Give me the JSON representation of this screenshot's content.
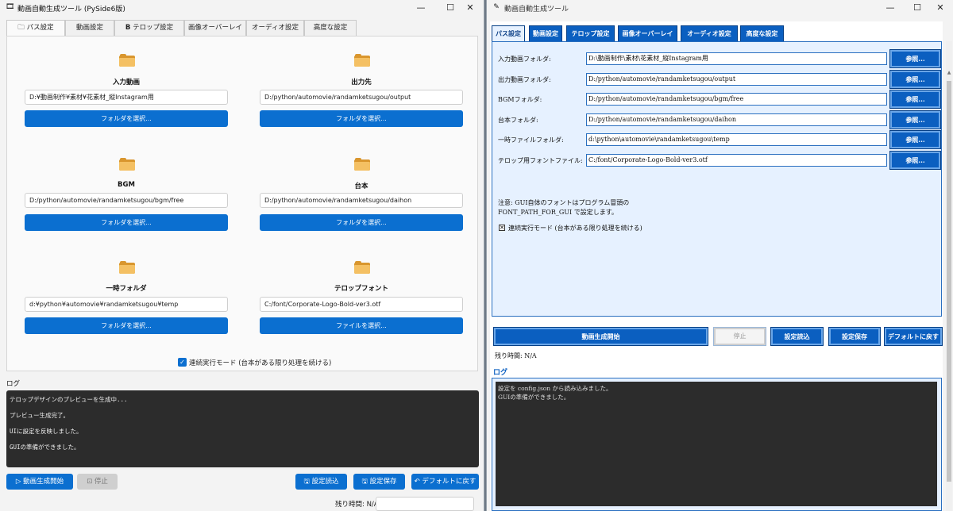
{
  "w1": {
    "title": "動画自動生成ツール (PySide6版)",
    "window_controls": {
      "minimize": "—",
      "maximize": "☐",
      "close": "✕"
    },
    "tabs": [
      {
        "icon": "🗀",
        "label": "パス設定"
      },
      {
        "icon": "",
        "label": "動画設定"
      },
      {
        "icon": "B",
        "label": "テロップ設定"
      },
      {
        "icon": "",
        "label": "画像オーバーレイ"
      },
      {
        "icon": "",
        "label": "オーディオ設定"
      },
      {
        "icon": "",
        "label": "高度な設定"
      }
    ],
    "paths": [
      {
        "label": "入力動画",
        "value": "D:¥動画制作¥素材¥花素材_縦Instagram用",
        "button": "フォルダを選択..."
      },
      {
        "label": "出力先",
        "value": "D:/python/automovie/randamketsugou/output",
        "button": "フォルダを選択..."
      },
      {
        "label": "BGM",
        "value": "D:/python/automovie/randamketsugou/bgm/free",
        "button": "フォルダを選択..."
      },
      {
        "label": "台本",
        "value": "D:/python/automovie/randamketsugou/daihon",
        "button": "フォルダを選択..."
      },
      {
        "label": "一時フォルダ",
        "value": "d:¥python¥automovie¥randamketsugou¥temp",
        "button": "フォルダを選択..."
      },
      {
        "label": "テロップフォント",
        "value": "C:/font/Corporate-Logo-Bold-ver3.otf",
        "button": "ファイルを選択..."
      }
    ],
    "continuous": {
      "checked": "✓",
      "label": "連続実行モード (台本がある限り処理を続ける)"
    },
    "log_label": "ログ",
    "log_lines": [
      "テロップデザインのプレビューを生成中...",
      "プレビュー生成完了。",
      "UIに設定を反映しました。",
      "GUIの準備ができました。"
    ],
    "buttons": {
      "start": "▷ 動画生成開始",
      "stop": "⊡ 停止",
      "load": "🖫 設定読込",
      "save": "🖫 設定保存",
      "reset": "↶ デフォルトに戻す"
    },
    "remaining": "残り時間: N/A"
  },
  "w2": {
    "title": "動画自動生成ツール",
    "window_controls": {
      "minimize": "—",
      "maximize": "☐",
      "close": "✕"
    },
    "tabs": [
      "パス設定",
      "動画設定",
      "テロップ設定",
      "画像オーバーレイ",
      "オーディオ設定",
      "高度な設定"
    ],
    "rows": [
      {
        "label": "入力動画フォルダ:",
        "value": "D:\\動画制作\\素材\\花素材_縦Instagram用",
        "button": "参照..."
      },
      {
        "label": "出力動画フォルダ:",
        "value": "D:/python/automovie/randamketsugou/output",
        "button": "参照..."
      },
      {
        "label": "BGMフォルダ:",
        "value": "D:/python/automovie/randamketsugou/bgm/free",
        "button": "参照..."
      },
      {
        "label": "台本フォルダ:",
        "value": "D:/python/automovie/randamketsugou/daihon",
        "button": "参照..."
      },
      {
        "label": "一時ファイルフォルダ:",
        "value": "d:\\python\\automovie\\randamketsugou\\temp",
        "button": "参照..."
      },
      {
        "label": "テロップ用フォントファイル:",
        "value": "C:/font/Corporate-Logo-Bold-ver3.otf",
        "button": "参照..."
      }
    ],
    "note_line1": "注意: GUI自体のフォントはプログラム冒頭の",
    "note_line2": "FONT_PATH_FOR_GUI で設定します。",
    "continuous": {
      "checked": "✕",
      "label": "連続実行モード (台本がある限り処理を続ける)"
    },
    "buttons": {
      "start": "動画生成開始",
      "stop": "停止",
      "load": "設定読込",
      "save": "設定保存",
      "reset": "デフォルトに戻す"
    },
    "remaining": "残り時間: N/A",
    "log_label": "ログ",
    "log_lines": [
      "設定を config.json から読み込みました。",
      "GUIの準備ができました。"
    ]
  }
}
